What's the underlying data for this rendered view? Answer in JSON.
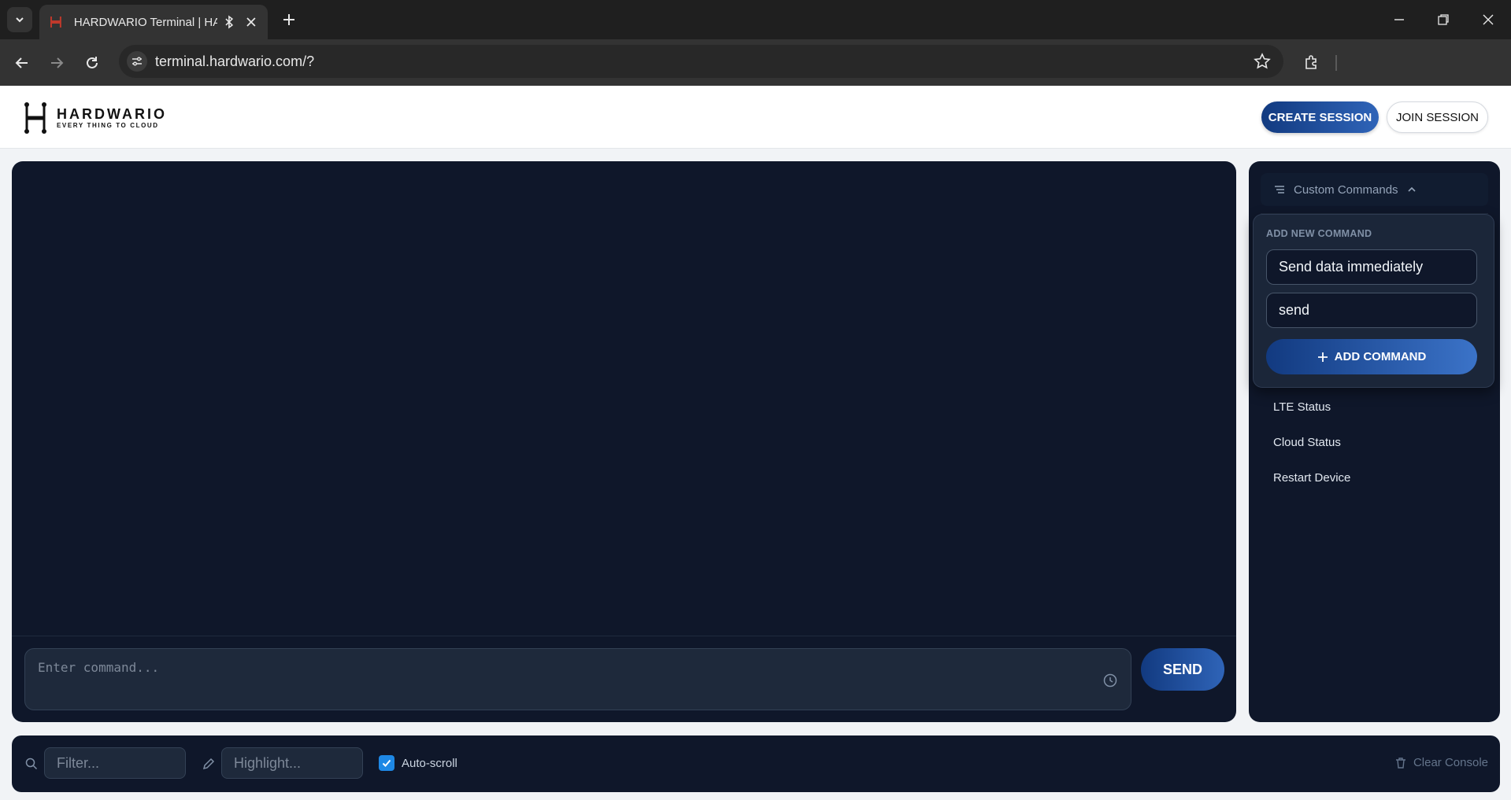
{
  "browser": {
    "tab_title": "HARDWARIO Terminal | HARDWARIO",
    "url": "terminal.hardwario.com/?"
  },
  "header": {
    "logo_name": "HARDWARIO",
    "logo_tagline": "EVERY THING TO CLOUD",
    "create_session": "CREATE SESSION",
    "join_session": "JOIN SESSION"
  },
  "terminal": {
    "input_placeholder": "Enter command...",
    "send_label": "SEND"
  },
  "sidebar": {
    "header_label": "Custom Commands",
    "add_title": "ADD NEW COMMAND",
    "name_value": "Send data immediately",
    "command_value": "send",
    "add_button": "ADD COMMAND",
    "commands": [
      {
        "label": "LTE Status"
      },
      {
        "label": "Cloud Status"
      },
      {
        "label": "Restart Device"
      }
    ]
  },
  "filter_bar": {
    "filter_placeholder": "Filter...",
    "highlight_placeholder": "Highlight...",
    "autoscroll_label": "Auto-scroll",
    "autoscroll_checked": true,
    "clear_label": "Clear Console"
  },
  "colors": {
    "accent": "#1e4a94",
    "panel_bg": "#0f172a",
    "checkbox": "#1e88e5"
  }
}
